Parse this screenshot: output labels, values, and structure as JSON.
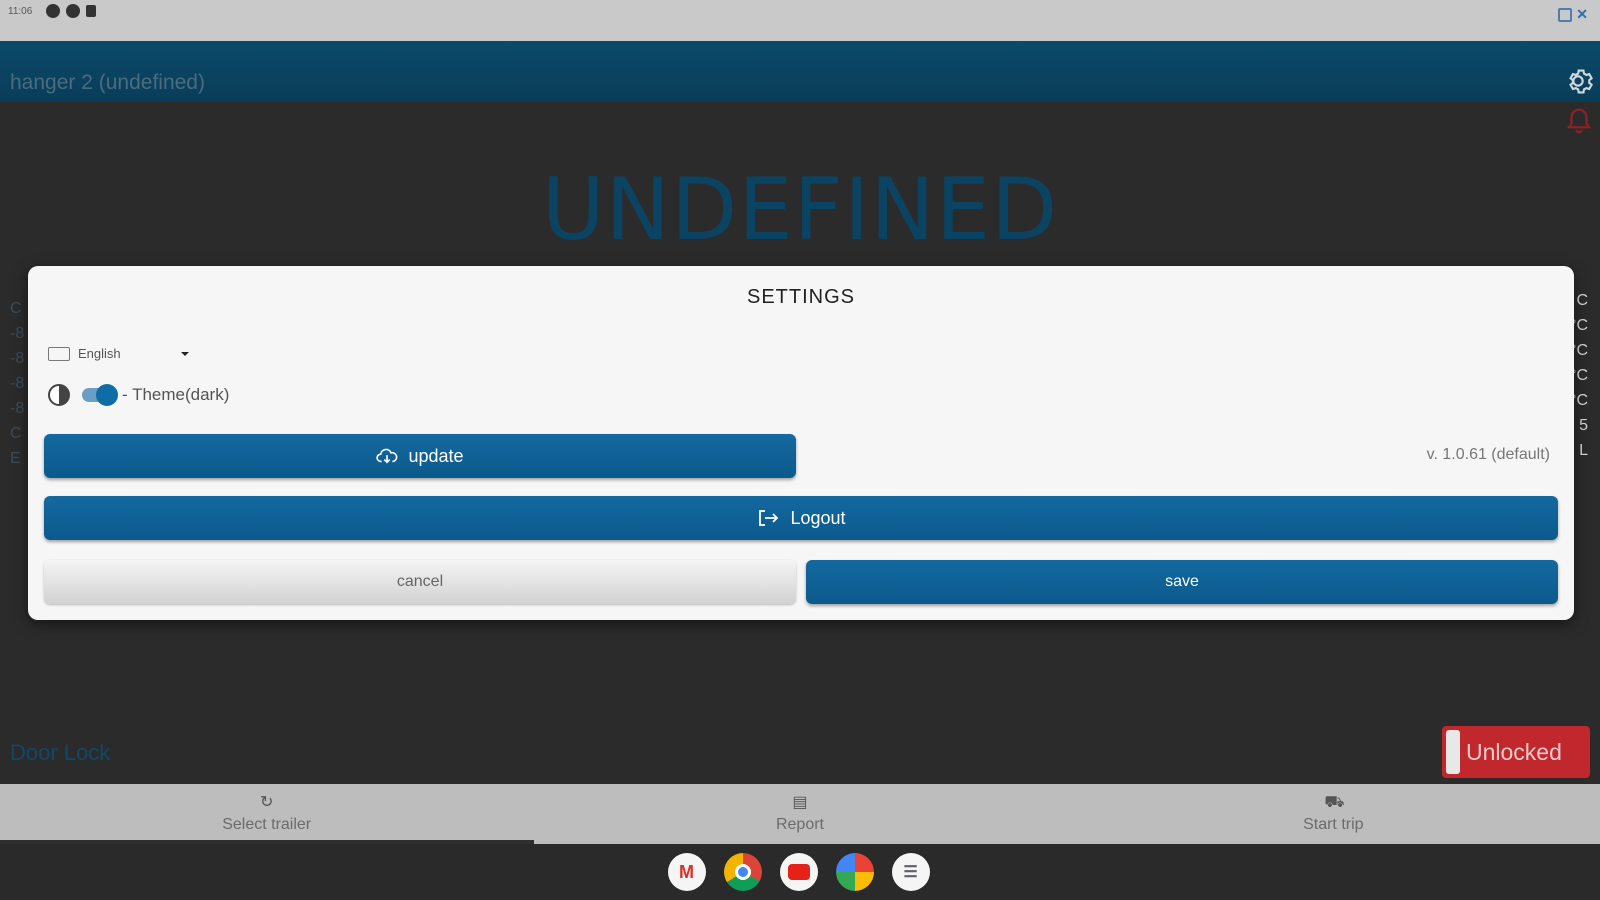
{
  "status_bar": {
    "time": "11:06"
  },
  "app_bar": {
    "title": "hanger 2 (undefined)"
  },
  "main": {
    "status_text": "UNDEFINED",
    "left_partial": [
      "C",
      "-8",
      "-8",
      "-8",
      "-8",
      "C",
      "E"
    ],
    "right_partial": [
      "C",
      "°C",
      "°C",
      "°C",
      "°C",
      "5",
      "L"
    ],
    "door_lock_label": "Door Lock",
    "door_lock_state": "Unlocked"
  },
  "dialog": {
    "title": "SETTINGS",
    "language": "English",
    "theme_label": "- Theme(dark)",
    "theme_dark_enabled": true,
    "update_label": "update",
    "version": "v. 1.0.61 (default)",
    "logout_label": "Logout",
    "cancel_label": "cancel",
    "save_label": "save"
  },
  "bottom_nav": {
    "items": [
      {
        "label": "Select trailer",
        "icon": "refresh-icon"
      },
      {
        "label": "Report",
        "icon": "document-icon"
      },
      {
        "label": "Start trip",
        "icon": "truck-icon"
      }
    ],
    "active_index": 0
  },
  "taskbar": {
    "apps": [
      "gmail-icon",
      "chrome-icon",
      "youtube-icon",
      "photos-icon",
      "messages-icon"
    ]
  },
  "colors": {
    "accent": "#0b5a8c",
    "app_bar": "#0b4a6a",
    "danger": "#c0282e"
  }
}
